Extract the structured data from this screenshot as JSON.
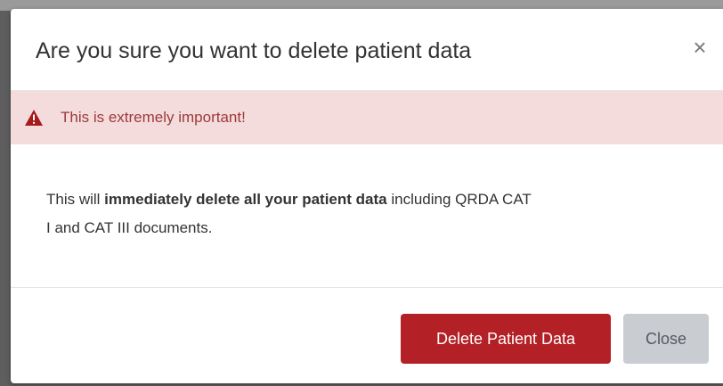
{
  "dialog": {
    "title": "Are you sure you want to delete patient data",
    "close_glyph": "×"
  },
  "alert": {
    "icon": "warning-triangle-icon",
    "text": "This is extremely important!",
    "color": "#9b3a3a",
    "background": "#f5dcdc"
  },
  "body": {
    "text_before": "This will ",
    "text_bold": "immediately delete all your patient data",
    "text_after_line1": " including QRDA CAT",
    "text_line2": "I and CAT III documents."
  },
  "footer": {
    "delete_label": "Delete Patient Data",
    "delete_color": "#b32025",
    "close_label": "Close",
    "close_color": "#c9cdd2"
  }
}
